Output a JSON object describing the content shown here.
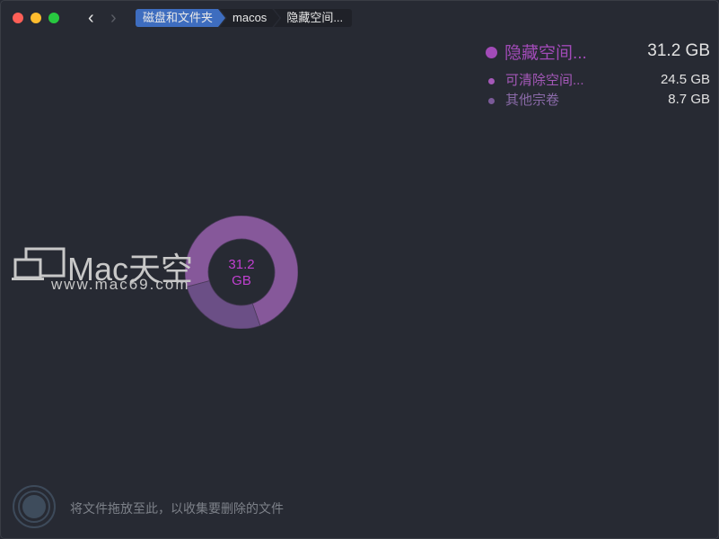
{
  "colors": {
    "bg": "#272a33",
    "accent": "#3e6dbf",
    "slice_main": "#86589a",
    "slice_other": "#6b4f86",
    "center_text": "#c040d0"
  },
  "breadcrumb": [
    "磁盘和文件夹",
    "macos",
    "隐藏空间..."
  ],
  "legend": {
    "main": {
      "label": "隐藏空间...",
      "value": "31.2 GB"
    },
    "items": [
      {
        "label": "可清除空间...",
        "value": "24.5 GB",
        "color": "#a458b8"
      },
      {
        "label": "其他宗卷",
        "value": "8.7 GB",
        "color": "#7a5a98"
      }
    ]
  },
  "chart_data": {
    "type": "pie",
    "center_label": [
      "31.2",
      "GB"
    ],
    "total": 31.2,
    "slices": [
      {
        "name": "可清除空间...",
        "value": 24.5
      },
      {
        "name": "其他宗卷",
        "value": 8.7
      }
    ]
  },
  "watermark": {
    "brand": "Mac天空",
    "url": "www.mac69.com"
  },
  "drop_hint": "将文件拖放至此，以收集要删除的文件"
}
